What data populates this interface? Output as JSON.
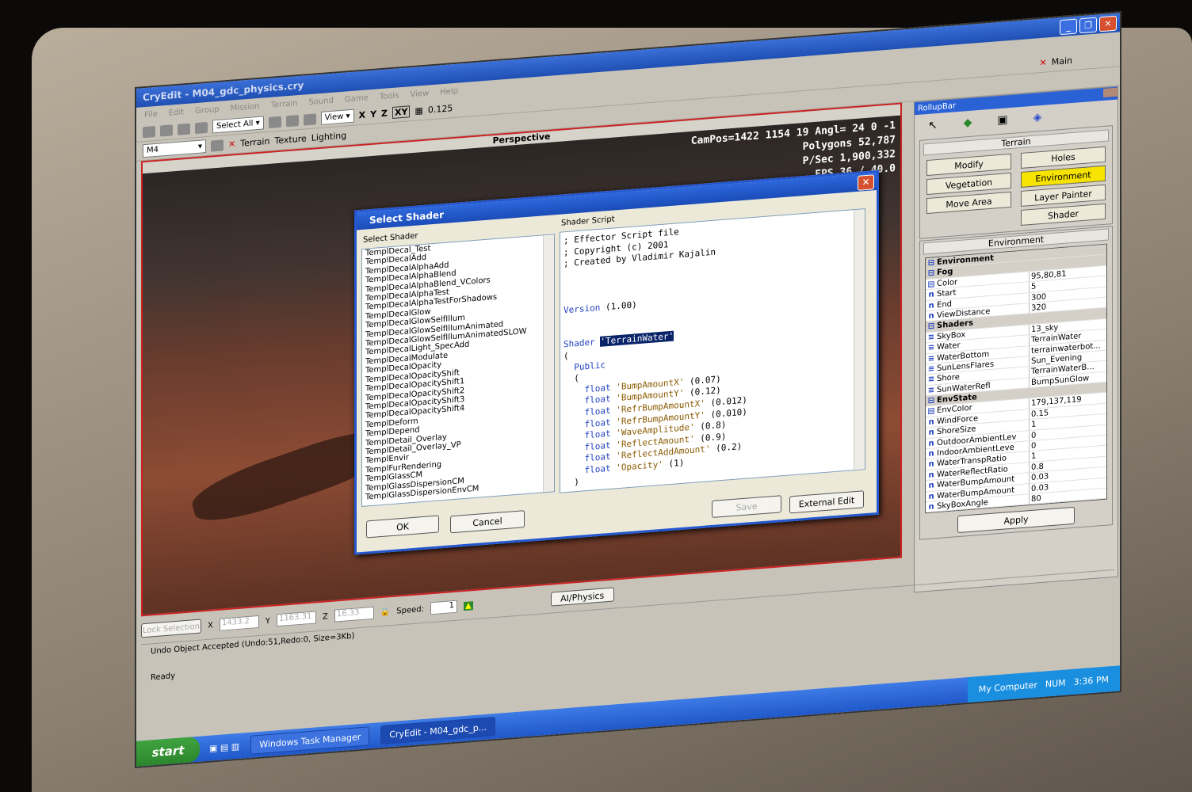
{
  "window": {
    "title": "CryEdit - M04_gdc_physics.cry"
  },
  "menu": [
    "File",
    "Edit",
    "Group",
    "Mission",
    "Terrain",
    "Sound",
    "Game",
    "Tools",
    "View",
    "Help"
  ],
  "toolbar": {
    "select_all": "Select All",
    "view": "View",
    "x": "X",
    "y": "Y",
    "z": "Z",
    "xy": "XY",
    "grid": "0.125",
    "main": "Main",
    "layer": "M4",
    "terrain": "Terrain",
    "texture": "Texture",
    "lighting": "Lighting"
  },
  "viewport": {
    "title": "Perspective",
    "campos": "CamPos=1422 1154 19 Angl= 24 0 -1",
    "polygons": "Polygons 52,787",
    "psec": "P/Sec 1,900,332",
    "fps": "FPS 36 / 40.0"
  },
  "dialog": {
    "title": "Select Shader",
    "list_label": "Select Shader",
    "script_label": "Shader Script",
    "shaders": [
      "TemplDecal_Test",
      "TemplDecalAdd",
      "TemplDecalAlphaAdd",
      "TemplDecalAlphaBlend",
      "TemplDecalAlphaBlend_VColors",
      "TemplDecalAlphaTest",
      "TemplDecalAlphaTestForShadows",
      "TemplDecalGlow",
      "TemplDecalGlowSelfIllum",
      "TemplDecalGlowSelfIllumAnimated",
      "TemplDecalGlowSelfIllumAnimatedSLOW",
      "TemplDecalLight_SpecAdd",
      "TemplDecalModulate",
      "TemplDecalOpacity",
      "TemplDecalOpacityShift",
      "TemplDecalOpacityShift1",
      "TemplDecalOpacityShift2",
      "TemplDecalOpacityShift3",
      "TemplDecalOpacityShift4",
      "TemplDeform",
      "TemplDepend",
      "TemplDetail_Overlay",
      "TemplDetail_Overlay_VP",
      "TemplEnvir",
      "TemplFurRendering",
      "TemplGlassCM",
      "TemplGlassDispersionCM",
      "TemplGlassDispersionEnvCM"
    ],
    "script": {
      "c1": "; Effector Script file",
      "c2": "; Copyright (c) 2001",
      "c3": "; Created by Vladimir Kajalin",
      "version_kw": "Version",
      "version_val": " (1.00)",
      "shader_kw": "Shader",
      "shader_name": "'TerrainWater'",
      "open1": "(",
      "public": "  Public",
      "open2": "  (",
      "params": [
        {
          "kw": "float",
          "name": "'BumpAmountX'",
          "val": "(0.07)"
        },
        {
          "kw": "float",
          "name": "'BumpAmountY'",
          "val": "(0.12)"
        },
        {
          "kw": "float",
          "name": "'RefrBumpAmountX'",
          "val": "(0.012)"
        },
        {
          "kw": "float",
          "name": "'RefrBumpAmountY'",
          "val": "(0.010)"
        },
        {
          "kw": "float",
          "name": "'WaveAmplitude'",
          "val": "(0.8)"
        },
        {
          "kw": "float",
          "name": "'ReflectAmount'",
          "val": "(0.9)"
        },
        {
          "kw": "float",
          "name": "'ReflectAddAmount'",
          "val": "(0.2)"
        },
        {
          "kw": "float",
          "name": "'Opacity'",
          "val": "(1)"
        }
      ],
      "close2": "  )"
    },
    "ok": "OK",
    "cancel": "Cancel",
    "save": "Save",
    "external_edit": "External Edit"
  },
  "rollup": {
    "title": "RollupBar",
    "terrain_title": "Terrain",
    "buttons": [
      "Modify",
      "Holes",
      "Vegetation",
      "Environment",
      "Move Area",
      "Layer Painter",
      "Shader"
    ],
    "env_title": "Environment",
    "props": [
      {
        "t": "hdr",
        "n": "Environment",
        "v": ""
      },
      {
        "t": "hdr",
        "n": "Fog",
        "v": ""
      },
      {
        "t": "c",
        "n": "Color",
        "v": "95,80,81",
        "sw": "#5f5051"
      },
      {
        "t": "n",
        "n": "Start",
        "v": "5"
      },
      {
        "t": "n",
        "n": "End",
        "v": "300"
      },
      {
        "t": "n",
        "n": "ViewDistance",
        "v": "320"
      },
      {
        "t": "hdr",
        "n": "Shaders",
        "v": ""
      },
      {
        "t": "s",
        "n": "SkyBox",
        "v": "13_sky"
      },
      {
        "t": "s",
        "n": "Water",
        "v": "TerrainWater"
      },
      {
        "t": "s",
        "n": "WaterBottom",
        "v": "terrainwaterbot..."
      },
      {
        "t": "s",
        "n": "SunLensFlares",
        "v": "Sun_Evening"
      },
      {
        "t": "s",
        "n": "Shore",
        "v": "TerrainWaterB..."
      },
      {
        "t": "s",
        "n": "SunWaterRefl",
        "v": "BumpSunGlow"
      },
      {
        "t": "hdr",
        "n": "EnvState",
        "v": ""
      },
      {
        "t": "c",
        "n": "EnvColor",
        "v": "179,137,119",
        "sw": "#b38977"
      },
      {
        "t": "n",
        "n": "WindForce",
        "v": "0.15"
      },
      {
        "t": "n",
        "n": "ShoreSize",
        "v": "1"
      },
      {
        "t": "n",
        "n": "OutdoorAmbientLev",
        "v": "0"
      },
      {
        "t": "n",
        "n": "IndoorAmbientLeve",
        "v": "0"
      },
      {
        "t": "n",
        "n": "WaterTranspRatio",
        "v": "1"
      },
      {
        "t": "n",
        "n": "WaterReflectRatio",
        "v": "0.8"
      },
      {
        "t": "n",
        "n": "WaterBumpAmount",
        "v": "0.03"
      },
      {
        "t": "n",
        "n": "WaterBumpAmount",
        "v": "0.03"
      },
      {
        "t": "n",
        "n": "SkyBoxAngle",
        "v": "80"
      }
    ],
    "apply": "Apply"
  },
  "status": {
    "lock": "Lock Selection",
    "x_label": "X",
    "x_val": "1433.2",
    "y_label": "Y",
    "y_val": "1163.31",
    "z_label": "Z",
    "z_val": "16.33",
    "speed_label": "Speed:",
    "speed_val": "1",
    "ai": "AI/Physics",
    "log": "Undo Object Accepted (Undo:51,Redo:0, Size=3Kb)",
    "ready": "Ready"
  },
  "taskbar": {
    "start": "start",
    "task1": "Windows Task Manager",
    "task2": "CryEdit - M04_gdc_p...",
    "tray_label": "My Computer",
    "num": "NUM",
    "clock": "3:36 PM"
  }
}
